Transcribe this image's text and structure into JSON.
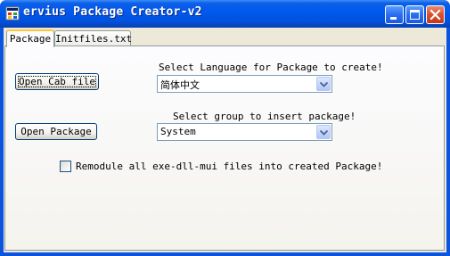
{
  "window": {
    "title": "ervius Package Creator-v2"
  },
  "tabs": [
    {
      "label": "Package"
    },
    {
      "label": "Initfiles.txt"
    }
  ],
  "package_tab": {
    "open_cab_label": "Open Cab file",
    "open_package_label": "Open Package",
    "language_prompt": "Select Language for Package to create!",
    "language_value": "简体中文",
    "group_prompt": "Select group to insert package!",
    "group_value": "System",
    "remodule_label": "Remodule all exe-dll-mui files into created Package!",
    "remodule_checked": false
  },
  "colors": {
    "titlebar": "#0058ee",
    "client_bg": "#ece9d8",
    "close_button": "#d6502e",
    "active_tab_highlight": "#ffc83c"
  },
  "icons": [
    "app-icon",
    "minimize-icon",
    "maximize-icon",
    "close-icon",
    "dropdown-arrow-icon"
  ]
}
